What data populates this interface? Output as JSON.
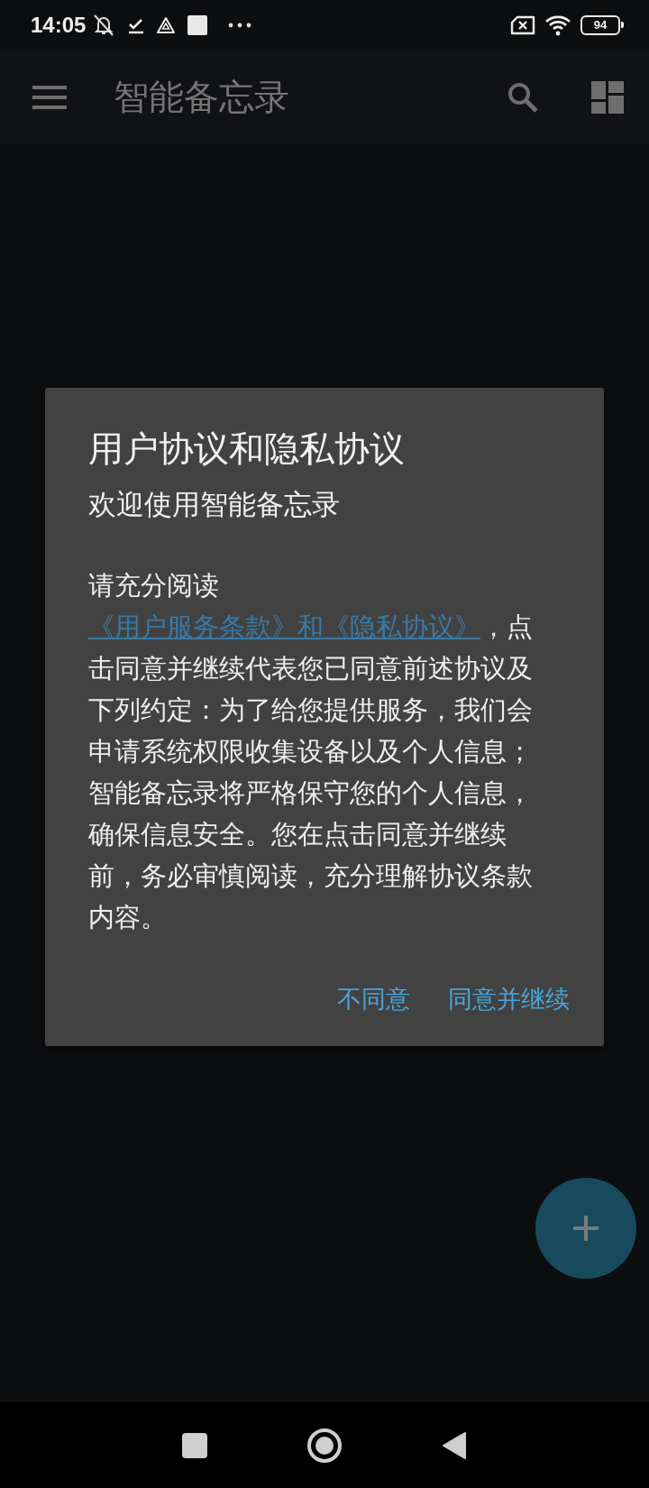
{
  "status_bar": {
    "time": "14:05",
    "battery": "94"
  },
  "toolbar": {
    "title": "智能备忘录"
  },
  "dialog": {
    "title": "用户协议和隐私协议",
    "subtitle": "欢迎使用智能备忘录",
    "body": {
      "before": "请充分阅读",
      "link": "《用户服务条款》和《隐私协议》",
      "after": "，点击同意并继续代表您已同意前述协议及下列约定：为了给您提供服务，我们会申请系统权限收集设备以及个人信息；"
    },
    "note": "智能备忘录将严格保守您的个人信息，确保信息安全。您在点击同意并继续前，务必审慎阅读，充分理解协议条款内容。",
    "buttons": [
      {
        "label": "不同意"
      },
      {
        "label": "同意并继续"
      }
    ]
  }
}
